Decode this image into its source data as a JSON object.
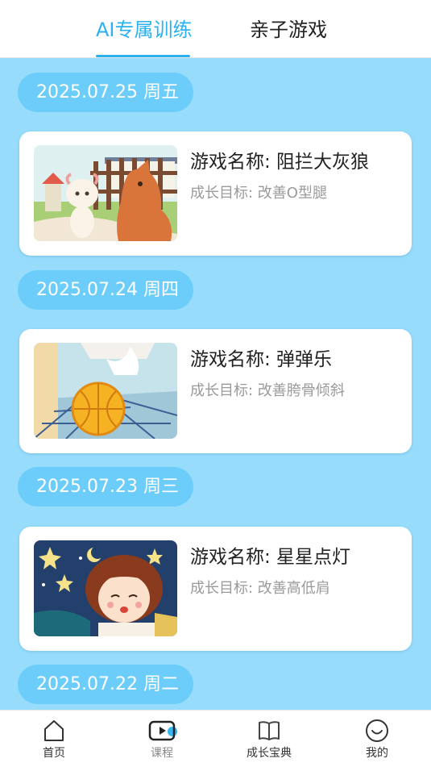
{
  "tabs": [
    {
      "label": "AI专属训练",
      "active": true
    },
    {
      "label": "亲子游戏",
      "active": false
    }
  ],
  "entries": [
    {
      "date": "2025.07.25 周五",
      "game_name": "游戏名称: 阻拦大灰狼",
      "goal": "成长目标: 改善O型腿",
      "image": "wolf-and-sheep-illustration"
    },
    {
      "date": "2025.07.24 周四",
      "game_name": "游戏名称: 弹弹乐",
      "goal": "成长目标: 改善胯骨倾斜",
      "image": "basketball-hoop-illustration"
    },
    {
      "date": "2025.07.23 周三",
      "game_name": "游戏名称: 星星点灯",
      "goal": "成长目标: 改善高低肩",
      "image": "girl-with-stars-illustration"
    },
    {
      "date": "2025.07.22 周二"
    }
  ],
  "bottom_nav": [
    {
      "label": "首页",
      "icon": "home-icon"
    },
    {
      "label": "课程",
      "icon": "course-play-icon"
    },
    {
      "label": "成长宝典",
      "icon": "book-icon"
    },
    {
      "label": "我的",
      "icon": "smile-profile-icon"
    }
  ],
  "colors": {
    "accent": "#2bb1ef",
    "background": "#97dcfb",
    "date_pill": "#6ccdfb",
    "card": "#ffffff"
  }
}
